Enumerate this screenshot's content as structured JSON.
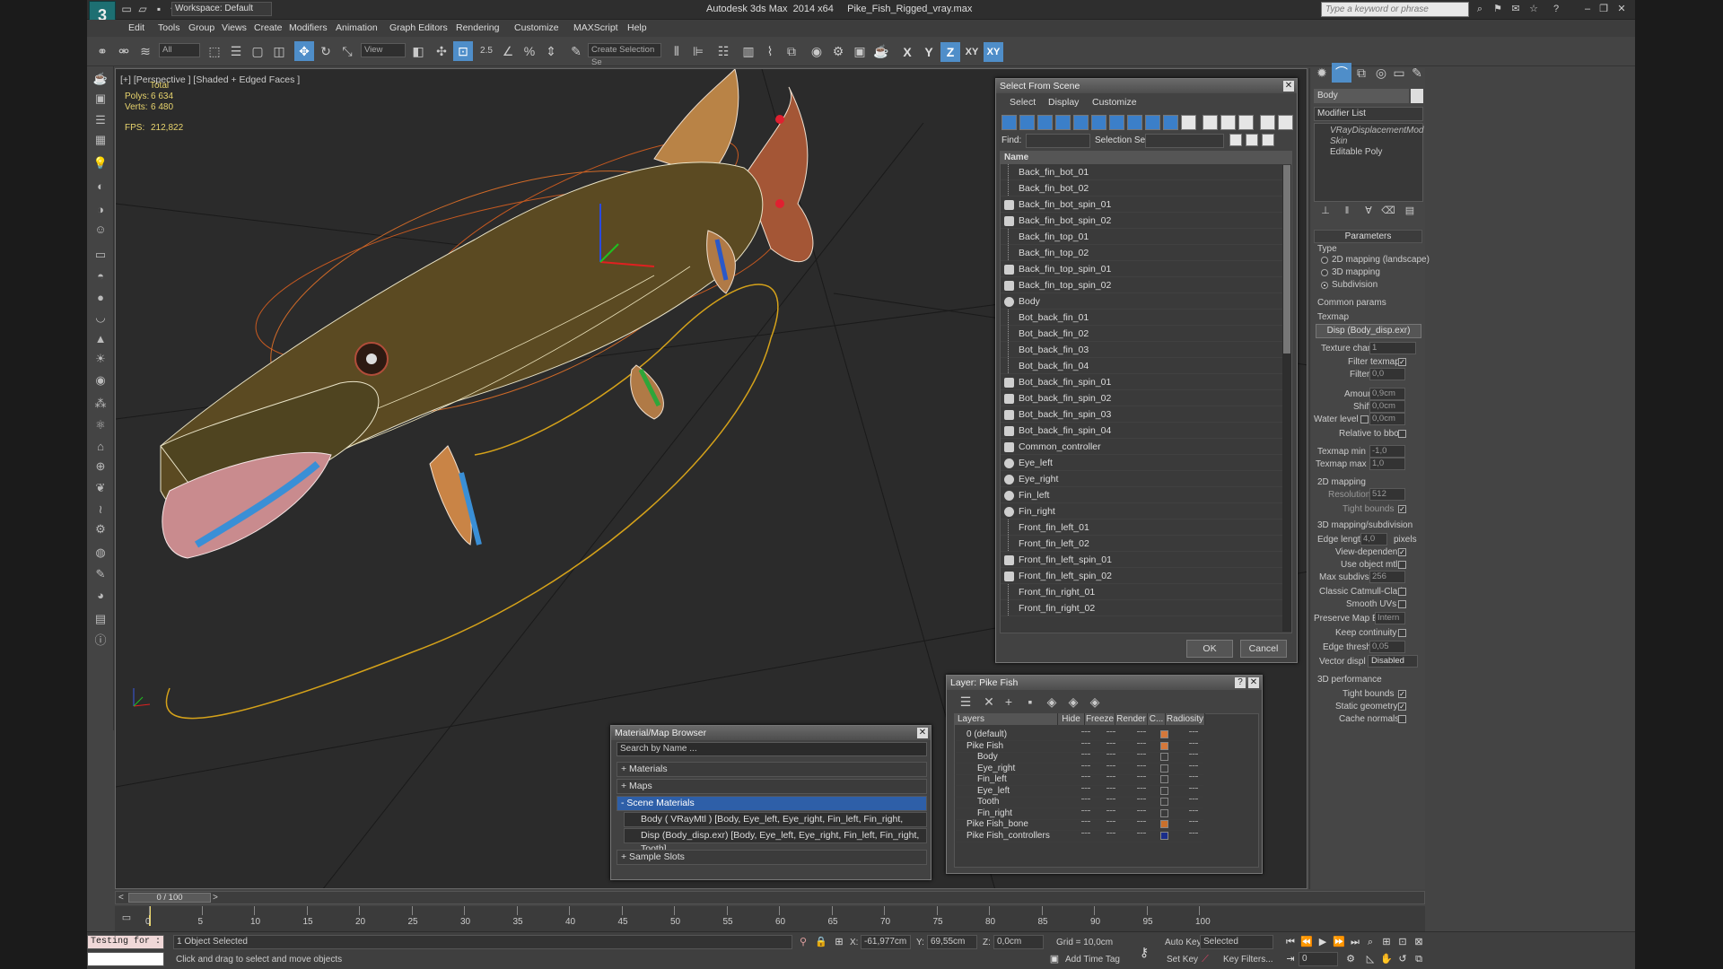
{
  "app": {
    "title": "Autodesk 3ds Max  2014 x64     Pike_Fish_Rigged_vray.max",
    "workspace": "Workspace: Default",
    "search_placeholder": "Type a keyword or phrase",
    "logo": "3"
  },
  "menu": [
    "Edit",
    "Tools",
    "Group",
    "Views",
    "Create",
    "Modifiers",
    "Animation",
    "Graph Editors",
    "Rendering",
    "Customize",
    "MAXScript",
    "Help"
  ],
  "toolbar": {
    "filter": "All",
    "ref_coord": "View",
    "selection_set": "Create Selection Se",
    "axes": [
      "X",
      "Y",
      "Z",
      "XY",
      "XY"
    ],
    "snap": "2.5"
  },
  "viewport": {
    "label": "[+] [Perspective ] [Shaded + Edged Faces ]",
    "stats": {
      "total_label": "Total",
      "polys_label": "Polys:",
      "polys_value": "6 634",
      "verts_label": "Verts:",
      "verts_value": "6 480",
      "fps_label": "FPS:",
      "fps_value": "212,822"
    }
  },
  "select_from_scene": {
    "title": "Select From Scene",
    "menus": [
      "Select",
      "Display",
      "Customize"
    ],
    "find_label": "Find:",
    "selection_set_label": "Selection Set:",
    "column_name": "Name",
    "items": [
      {
        "name": "Back_fin_bot_01",
        "icon": "bone"
      },
      {
        "name": "Back_fin_bot_02",
        "icon": "bone"
      },
      {
        "name": "Back_fin_bot_spin_01",
        "icon": "helper"
      },
      {
        "name": "Back_fin_bot_spin_02",
        "icon": "helper"
      },
      {
        "name": "Back_fin_top_01",
        "icon": "bone"
      },
      {
        "name": "Back_fin_top_02",
        "icon": "bone"
      },
      {
        "name": "Back_fin_top_spin_01",
        "icon": "helper"
      },
      {
        "name": "Back_fin_top_spin_02",
        "icon": "helper"
      },
      {
        "name": "Body",
        "icon": "geometry"
      },
      {
        "name": "Bot_back_fin_01",
        "icon": "bone"
      },
      {
        "name": "Bot_back_fin_02",
        "icon": "bone"
      },
      {
        "name": "Bot_back_fin_03",
        "icon": "bone"
      },
      {
        "name": "Bot_back_fin_04",
        "icon": "bone"
      },
      {
        "name": "Bot_back_fin_spin_01",
        "icon": "helper"
      },
      {
        "name": "Bot_back_fin_spin_02",
        "icon": "helper"
      },
      {
        "name": "Bot_back_fin_spin_03",
        "icon": "helper"
      },
      {
        "name": "Bot_back_fin_spin_04",
        "icon": "helper"
      },
      {
        "name": "Common_controller",
        "icon": "helper"
      },
      {
        "name": "Eye_left",
        "icon": "geometry"
      },
      {
        "name": "Eye_right",
        "icon": "geometry"
      },
      {
        "name": "Fin_left",
        "icon": "geometry"
      },
      {
        "name": "Fin_right",
        "icon": "geometry"
      },
      {
        "name": "Front_fin_left_01",
        "icon": "bone"
      },
      {
        "name": "Front_fin_left_02",
        "icon": "bone"
      },
      {
        "name": "Front_fin_left_spin_01",
        "icon": "helper"
      },
      {
        "name": "Front_fin_left_spin_02",
        "icon": "helper"
      },
      {
        "name": "Front_fin_right_01",
        "icon": "bone"
      },
      {
        "name": "Front_fin_right_02",
        "icon": "bone"
      }
    ],
    "ok": "OK",
    "cancel": "Cancel"
  },
  "layer_dialog": {
    "title": "Layer: Pike Fish",
    "help": "?",
    "columns": [
      "Layers",
      "Hide",
      "Freeze",
      "Render",
      "C...",
      "Radiosity"
    ],
    "rows": [
      {
        "name": "0 (default)",
        "indent": 0,
        "color": "#d5783a"
      },
      {
        "name": "Pike Fish",
        "indent": 0,
        "color": "#d5783a"
      },
      {
        "name": "Body",
        "indent": 1,
        "color": ""
      },
      {
        "name": "Eye_right",
        "indent": 1,
        "color": ""
      },
      {
        "name": "Fin_left",
        "indent": 1,
        "color": ""
      },
      {
        "name": "Eye_left",
        "indent": 1,
        "color": ""
      },
      {
        "name": "Tooth",
        "indent": 1,
        "color": ""
      },
      {
        "name": "Fin_right",
        "indent": 1,
        "color": ""
      },
      {
        "name": "Pike Fish_bone",
        "indent": 0,
        "color": "#c8702c"
      },
      {
        "name": "Pike Fish_controllers",
        "indent": 0,
        "color": "#1a2d8a"
      }
    ]
  },
  "material_browser": {
    "title": "Material/Map Browser",
    "search_placeholder": "Search by Name ...",
    "sections": [
      "+ Materials",
      "+ Maps",
      "- Scene Materials"
    ],
    "materials": [
      "Body  ( VRayMtl ) [Body, Eye_left, Eye_right, Fin_left, Fin_right, Tooth]",
      "Disp (Body_disp.exr) [Body, Eye_left, Eye_right, Fin_left, Fin_right, Tooth]"
    ],
    "sample_slots": "+ Sample Slots"
  },
  "command_panel": {
    "object_name": "Body",
    "modifier_list": "Modifier List",
    "stack": [
      "VRayDisplacementMod",
      "Skin",
      "Editable Poly"
    ],
    "parameters": "Parameters",
    "type_label": "Type",
    "type_options": [
      "2D mapping (landscape)",
      "3D mapping",
      "Subdivision"
    ],
    "type_selected": 2,
    "common_params": "Common params",
    "texmap_label": "Texmap",
    "texmap_value": "Disp (Body_disp.exr)",
    "texture_chan_label": "Texture chan",
    "texture_chan_value": "1",
    "filter_texmap": "Filter texmap",
    "filter_blur_label": "Filter blur",
    "filter_blur_value": "0,0",
    "amount_label": "Amount",
    "amount_value": "0,9cm",
    "shift_label": "Shift",
    "shift_value": "0,0cm",
    "water_level_label": "Water level",
    "water_level_value": "0,0cm",
    "relative_bbox": "Relative to bbox",
    "texmap_min_label": "Texmap min",
    "texmap_min_value": "-1,0",
    "texmap_max_label": "Texmap max",
    "texmap_max_value": "1,0",
    "mapping2d": "2D mapping",
    "resolution_label": "Resolution",
    "resolution_value": "512",
    "tight_bounds": "Tight bounds",
    "mapping3d": "3D mapping/subdivision",
    "edge_length_label": "Edge length",
    "edge_length_value": "4,0",
    "pixels": "pixels",
    "view_dependent": "View-dependent",
    "use_object_mtl": "Use object mtl",
    "max_subdivs_label": "Max subdivs",
    "max_subdivs_value": "256",
    "classic_catmull": "Classic Catmull-Clark",
    "smooth_uvs": "Smooth UVs",
    "preserve_map_bnd_label": "Preserve Map Bnd",
    "preserve_map_bnd_value": "Intern",
    "keep_continuity": "Keep continuity",
    "edge_thresh_label": "Edge thresh",
    "edge_thresh_value": "0,05",
    "vector_displ_label": "Vector displ",
    "vector_displ_value": "Disabled",
    "performance": "3D performance",
    "tight_bounds2": "Tight bounds",
    "static_geometry": "Static geometry",
    "cache_normals": "Cache normals"
  },
  "timeline": {
    "frame": "0 / 100",
    "ticks": [
      "0",
      "5",
      "10",
      "15",
      "20",
      "25",
      "30",
      "35",
      "40",
      "45",
      "50",
      "55",
      "60",
      "65",
      "70",
      "75",
      "80",
      "85",
      "90",
      "95",
      "100"
    ]
  },
  "status": {
    "maxscript": "Testing for :",
    "selected": "1 Object Selected",
    "prompt": "Click and drag to select and move objects",
    "x_label": "X:",
    "x_value": "-61,977cm",
    "y_label": "Y:",
    "y_value": "69,55cm",
    "z_label": "Z:",
    "z_value": "0,0cm",
    "grid": "Grid = 10,0cm",
    "auto_key": "Auto Key",
    "set_key": "Set Key",
    "selected_dd": "Selected",
    "key_filters": "Key Filters...",
    "add_time_tag": "Add Time Tag",
    "frame": "0"
  }
}
